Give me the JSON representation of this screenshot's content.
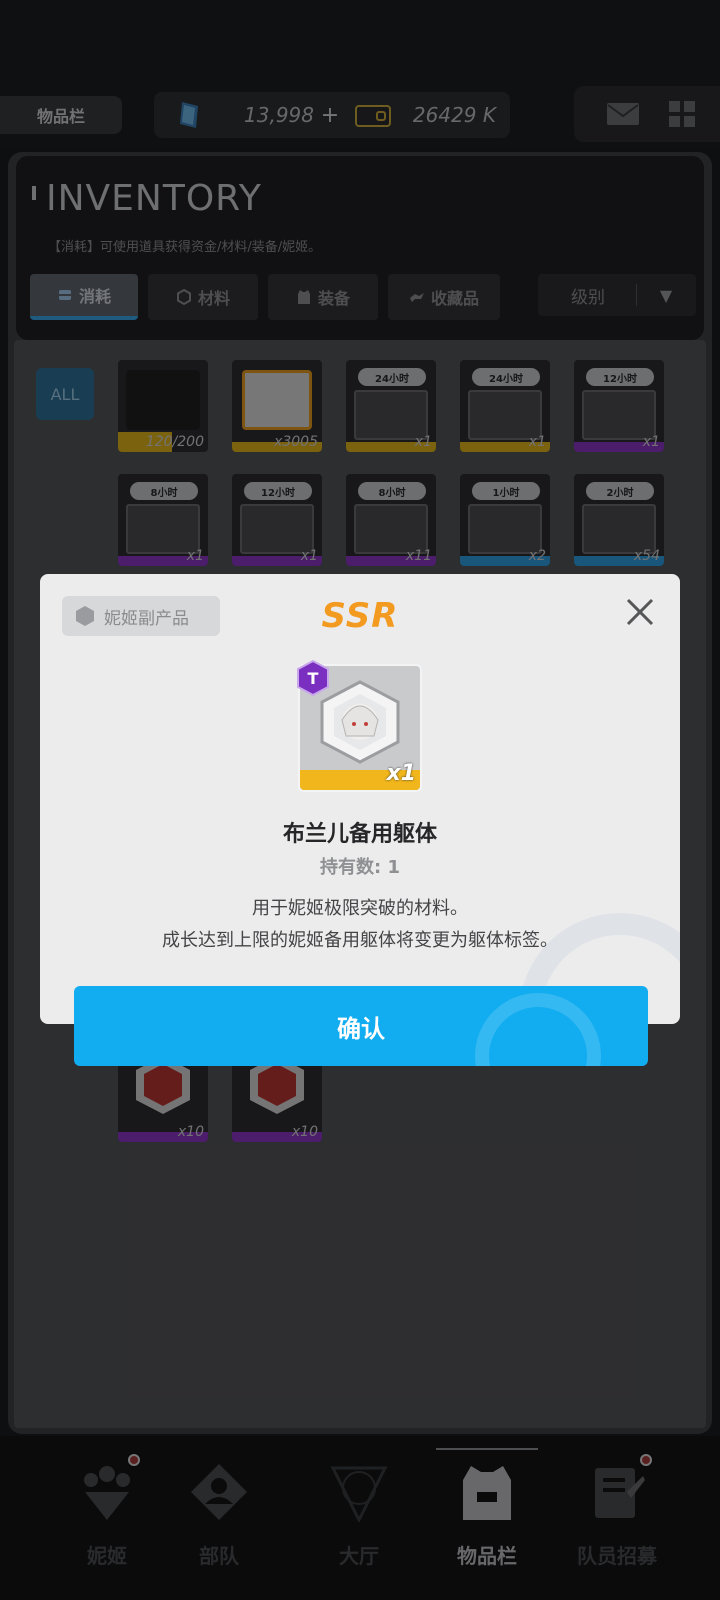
{
  "topbar": {
    "title": "物品栏",
    "gem_amount": "13,998",
    "gem_plus": "+",
    "credit_amount": "26429 K"
  },
  "inventory": {
    "title": "INVENTORY",
    "description": "【消耗】可使用道具获得资金/材料/装备/妮姬。",
    "tabs": [
      {
        "label": "消耗",
        "active": true
      },
      {
        "label": "材料",
        "active": false
      },
      {
        "label": "装备",
        "active": false
      },
      {
        "label": "收藏品",
        "active": false
      }
    ],
    "sort_label": "级别",
    "sort_arrow": "▼",
    "all_button": "ALL",
    "items_row1": [
      {
        "badge": "",
        "count": "120/200",
        "bar_color": "#e0b21a"
      },
      {
        "badge": "",
        "count": "x3005",
        "bar_color": "#e0b21a"
      },
      {
        "badge": "24小时",
        "count": "x1",
        "bar_color": "#e0b21a"
      },
      {
        "badge": "24小时",
        "count": "x1",
        "bar_color": "#e0b21a"
      },
      {
        "badge": "12小时",
        "count": "x1",
        "bar_color": "#8a35c4"
      }
    ],
    "items_row2": [
      {
        "badge": "8小时",
        "count": "x1",
        "bar_color": "#8a35c4"
      },
      {
        "badge": "12小时",
        "count": "x1",
        "bar_color": "#8a35c4"
      },
      {
        "badge": "8小时",
        "count": "x11",
        "bar_color": "#8a35c4"
      },
      {
        "badge": "1小时",
        "count": "x2",
        "bar_color": "#2f9de0"
      },
      {
        "badge": "2小时",
        "count": "x54",
        "bar_color": "#2f9de0"
      }
    ],
    "items_row_bottom": [
      {
        "count": "x10",
        "bar_color": "#8a35c4"
      },
      {
        "count": "x10",
        "bar_color": "#8a35c4"
      }
    ]
  },
  "modal": {
    "tag": "妮姬副产品",
    "rarity": "SSR",
    "tier_letter": "T",
    "item_count": "x1",
    "item_name": "布兰儿备用躯体",
    "owned": "持有数: 1",
    "description_lines": [
      "用于妮姬极限突破的材料。",
      "成长达到上限的妮姬备用躯体将变更为躯体标签。"
    ],
    "confirm": "确认"
  },
  "bottom_nav": [
    {
      "label": "妮姬",
      "icon": "nikke-icon",
      "active": false,
      "dot": true
    },
    {
      "label": "部队",
      "icon": "squad-icon",
      "active": false,
      "dot": false
    },
    {
      "label": "大厅",
      "icon": "lobby-icon",
      "active": false,
      "dot": false
    },
    {
      "label": "物品栏",
      "icon": "inventory-icon",
      "active": true,
      "dot": false
    },
    {
      "label": "队员招募",
      "icon": "recruit-icon",
      "active": false,
      "dot": true
    }
  ],
  "colors": {
    "accent": "#12acf0",
    "ssr": "#f39a20",
    "rarity_bar": "#f1b61b"
  }
}
